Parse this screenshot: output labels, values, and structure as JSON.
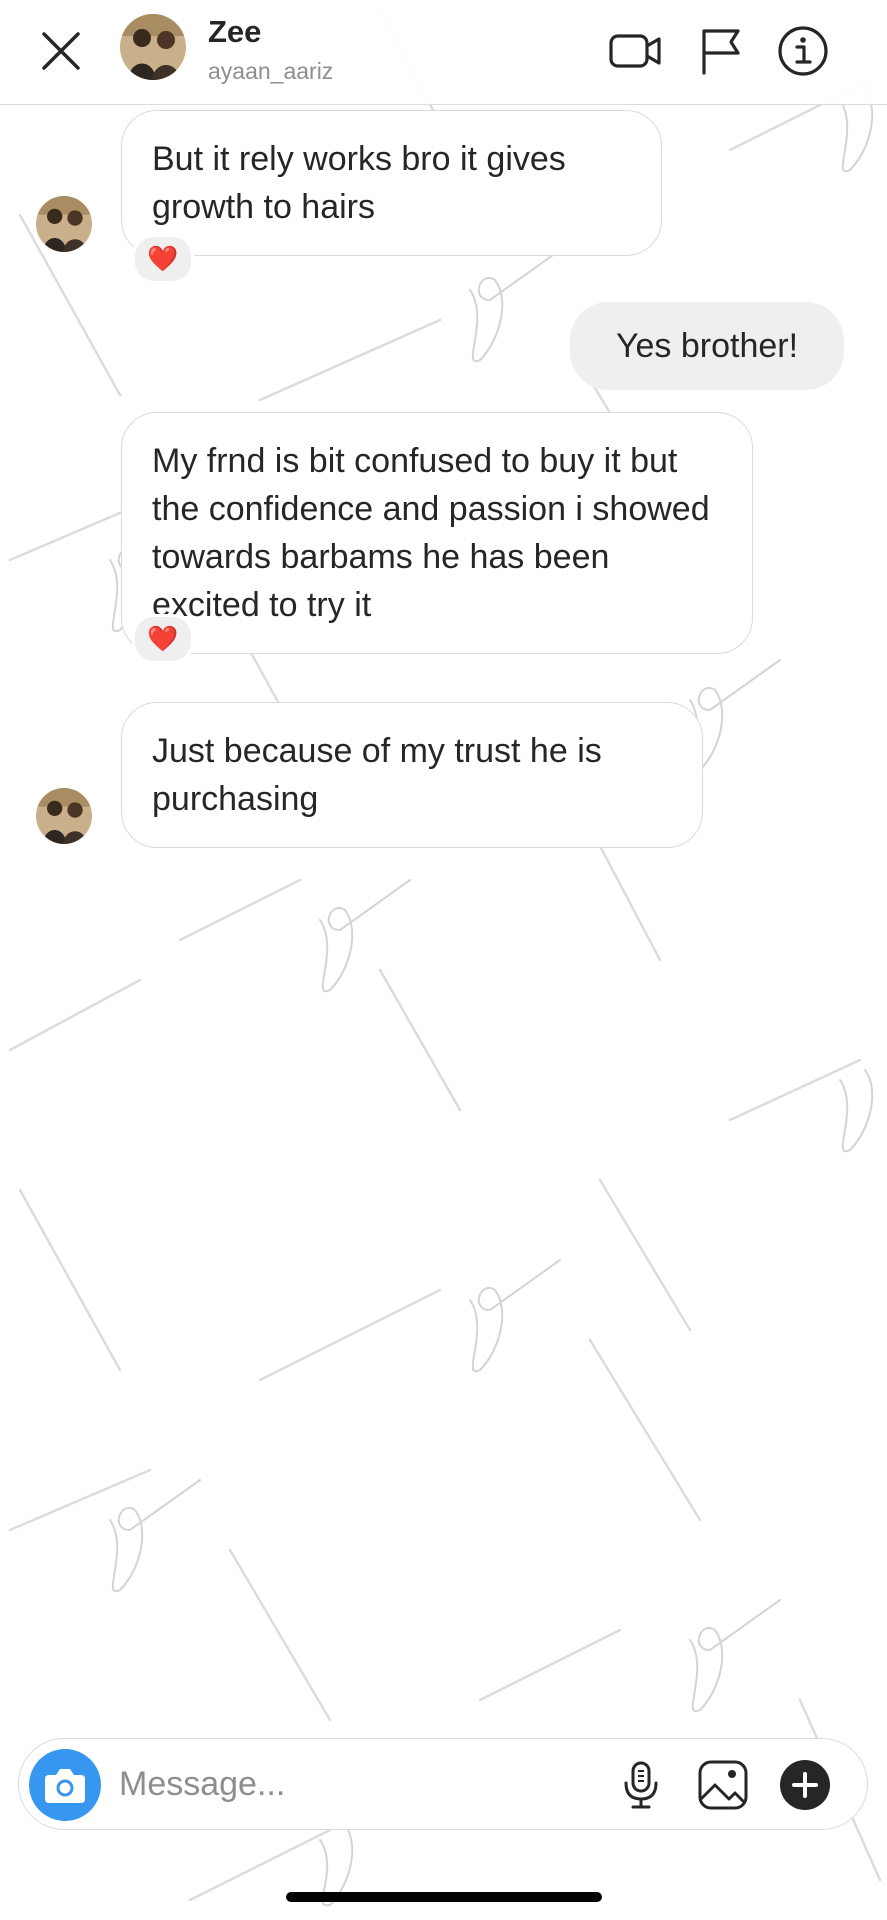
{
  "header": {
    "name": "Zee",
    "username": "ayaan_aariz",
    "icons": [
      "close-icon",
      "video-call-icon",
      "flag-icon",
      "info-icon"
    ]
  },
  "messages": [
    {
      "sender": "them",
      "text": "But it rely works bro it gives growth to hairs",
      "reaction": "❤️"
    },
    {
      "sender": "me",
      "text": "Yes brother!"
    },
    {
      "sender": "them",
      "text": "My frnd is bit confused to buy it but the confidence and passion i showed towards barbams he has been excited to try it",
      "reaction": "❤️"
    },
    {
      "sender": "them",
      "text": "Just because of my trust he is purchasing"
    }
  ],
  "composer": {
    "placeholder": "Message...",
    "icons": [
      "camera-icon",
      "microphone-icon",
      "gallery-icon",
      "plus-icon"
    ]
  },
  "colors": {
    "accent": "#3797f0",
    "outgoing_bubble": "#efefef",
    "border": "#dbdbdb",
    "secondary_text": "#8e8e8e",
    "heart": "#ed1c24"
  }
}
